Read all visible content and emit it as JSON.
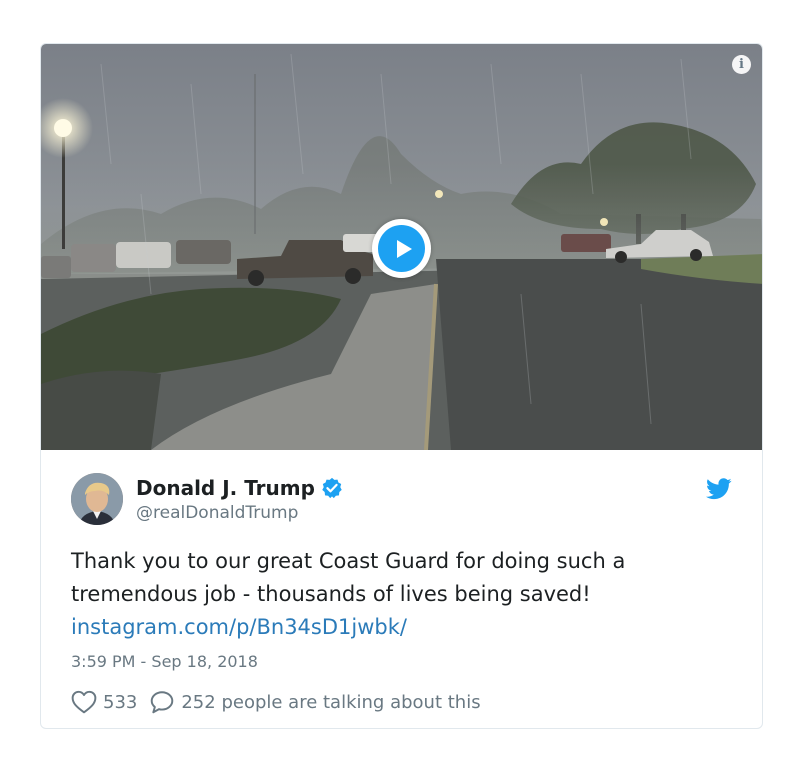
{
  "tweet": {
    "author": {
      "display_name": "Donald J. Trump",
      "handle": "@realDonaldTrump",
      "verified": true
    },
    "text": "Thank you to our great Coast Guard for doing such a tremendous job - thousands of lives being saved!",
    "link_text": "instagram.com/p/Bn34sD1jwbk/",
    "timestamp": "3:59 PM - Sep 18, 2018",
    "likes": "533",
    "conversation_text": "252 people are talking about this"
  },
  "media": {
    "type": "video",
    "description_icon": "play-icon"
  },
  "colors": {
    "accent": "#1da1f2",
    "link": "#2b7bb9",
    "secondary_text": "#697882",
    "border": "#e1e8ed"
  }
}
